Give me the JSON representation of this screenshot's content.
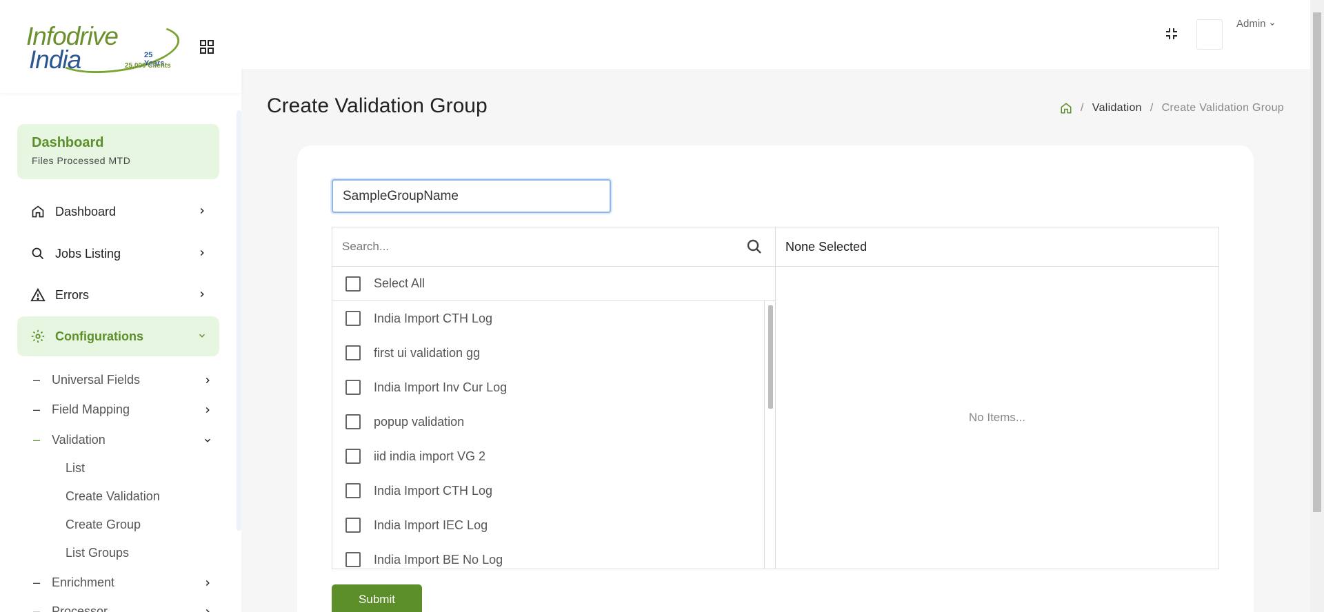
{
  "logo": {
    "line1": "Infodrive",
    "line2": "India",
    "years": "25 Years",
    "clients": "25,000 Clients"
  },
  "sidebar": {
    "dashboard_card": {
      "title": "Dashboard",
      "subtitle": "Files Processed MTD"
    },
    "items": [
      {
        "label": "Dashboard",
        "icon": "home-icon"
      },
      {
        "label": "Jobs Listing",
        "icon": "search-icon"
      },
      {
        "label": "Errors",
        "icon": "warning-icon"
      },
      {
        "label": "Configurations",
        "icon": "gear-icon",
        "active": true
      }
    ],
    "config_sub": [
      {
        "label": "Universal Fields"
      },
      {
        "label": "Field Mapping"
      },
      {
        "label": "Validation",
        "open": true
      },
      {
        "label": "Enrichment"
      },
      {
        "label": "Processor"
      }
    ],
    "validation_sub": [
      {
        "label": "List"
      },
      {
        "label": "Create Validation"
      },
      {
        "label": "Create Group"
      },
      {
        "label": "List Groups"
      }
    ]
  },
  "topbar": {
    "user": "Admin"
  },
  "page": {
    "title": "Create Validation Group",
    "breadcrumb": {
      "section": "Validation",
      "current": "Create Validation Group",
      "separator": "/"
    }
  },
  "form": {
    "group_name_value": "SampleGroupName",
    "search_placeholder": "Search...",
    "select_all_label": "Select All",
    "available_items": [
      "India Import CTH Log",
      "first ui validation gg",
      "India Import Inv Cur Log",
      "popup validation",
      "iid india import VG 2",
      "India Import CTH Log",
      "India Import IEC Log",
      "India Import BE No Log"
    ],
    "selected_header": "None Selected",
    "selected_empty": "No Items...",
    "submit_label": "Submit"
  },
  "colors": {
    "brand_green": "#5c8f2a",
    "active_bg": "#e7f6e1",
    "input_focus": "#8fb6e8"
  }
}
